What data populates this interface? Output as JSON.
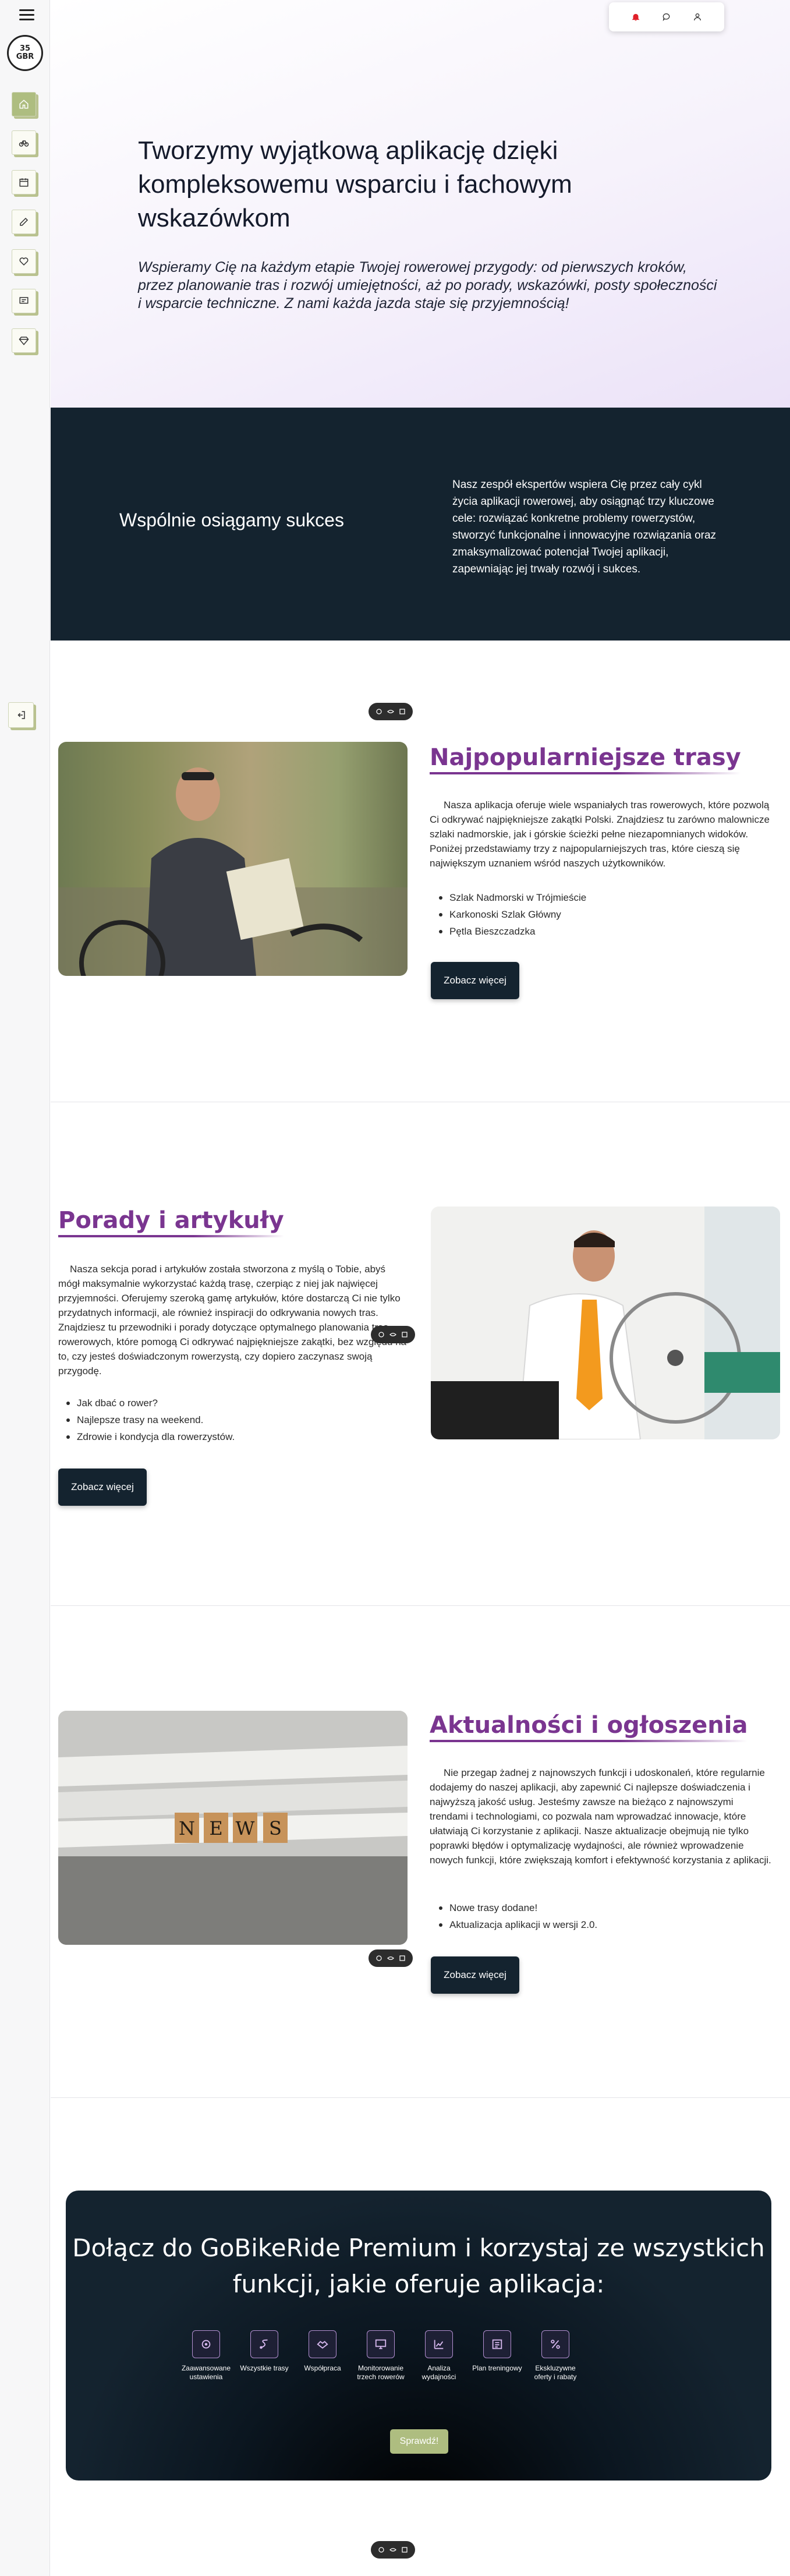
{
  "sidebar": {
    "logo_text_top": "35",
    "logo_text_bottom": "GBR",
    "items": [
      {
        "name": "home",
        "icon": "home-icon"
      },
      {
        "name": "routes",
        "icon": "bike-icon"
      },
      {
        "name": "calendar",
        "icon": "calendar-icon"
      },
      {
        "name": "edit",
        "icon": "edit-icon"
      },
      {
        "name": "community",
        "icon": "heart-hands-icon"
      },
      {
        "name": "messages",
        "icon": "message-icon"
      },
      {
        "name": "premium",
        "icon": "diamond-icon"
      }
    ],
    "logout_icon": "logout-icon"
  },
  "topbar": {
    "icons": [
      "bell-icon",
      "chat-icon",
      "user-icon"
    ],
    "bell_color": "#e0202a"
  },
  "hero": {
    "title": "Tworzymy wyjątkową aplikację dzięki kompleksowemu wsparciu i fachowym wskazówkom",
    "subtitle": "Wspieramy Cię na każdym etapie Twojej rowerowej przygody: od pierwszych kroków, przez planowanie tras i rozwój umiejętności, aż po porady, wskazówki, posty społeczności i wsparcie techniczne. Z nami każda jazda staje się przyjemnością!"
  },
  "success": {
    "title": "Wspólnie osiągamy sukces",
    "text": "Nasz zespół ekspertów wspiera Cię przez cały cykl życia aplikacji rowerowej, aby osiągnąć trzy kluczowe cele: rozwiązać konkretne problemy rowerzystów, stworzyć funkcjonalne i innowacyjne rozwiązania oraz zmaksymalizować potencjał Twojej aplikacji, zapewniając jej trwały rozwój i sukces."
  },
  "routes": {
    "title": "Najpopularniejsze trasy",
    "text": "Nasza aplikacja oferuje wiele wspaniałych tras rowerowych, które pozwolą Ci odkrywać najpiękniejsze zakątki Polski. Znajdziesz tu zarówno malownicze szlaki nadmorskie, jak i górskie ścieżki pełne niezapomnianych widoków. Poniżej przedstawiamy trzy z najpopularniejszych tras, które cieszą się największym uznaniem wśród naszych użytkowników.",
    "bullets": [
      "Szlak Nadmorski w Trójmieście",
      "Karkonoski Szlak Główny",
      "Pętla Bieszczadzka"
    ],
    "button": "Zobacz więcej"
  },
  "tips": {
    "title": "Porady i artykuły",
    "text": "Nasza sekcja porad i artykułów została stworzona z myślą o Tobie, abyś mógł maksymalnie wykorzystać każdą trasę, czerpiąc z niej jak najwięcej przyjemności. Oferujemy szeroką gamę artykułów, które dostarczą Ci nie tylko przydatnych informacji, ale również inspiracji do odkrywania nowych tras. Znajdziesz tu przewodniki i porady dotyczące optymalnego planowania tras rowerowych, które pomogą Ci odkrywać najpiękniejsze zakątki, bez względu na to, czy jesteś doświadczonym rowerzystą, czy dopiero zaczynasz swoją przygodę.",
    "bullets": [
      "Jak dbać o rower?",
      "Najlepsze trasy na weekend.",
      "Zdrowie i kondycja dla rowerzystów."
    ],
    "button": "Zobacz więcej"
  },
  "news": {
    "title": "Aktualności i ogłoszenia",
    "text": "Nie przegap żadnej z najnowszych funkcji i udoskonaleń, które regularnie dodajemy do naszej aplikacji, aby zapewnić Ci najlepsze doświadczenia i najwyższą jakość usług. Jesteśmy zawsze na bieżąco z najnowszymi trendami i technologiami, co pozwala nam wprowadzać innowacje, które ułatwiają Ci korzystanie z aplikacji. Nasze aktualizacje obejmują nie tylko poprawki błędów i optymalizację wydajności, ale również wprowadzenie nowych funkcji, które zwiększają komfort i efektywność korzystania z aplikacji.",
    "bullets": [
      "Nowe trasy dodane!",
      "Aktualizacja aplikacji w wersji 2.0."
    ],
    "button": "Zobacz więcej",
    "image_word": "NEWS"
  },
  "premium": {
    "title": "Dołącz do GoBikeRide Premium i korzystaj ze wszystkich funkcji, jakie oferuje aplikacja:",
    "features": [
      {
        "label": "Zaawansowane ustawienia",
        "icon": "settings-icon"
      },
      {
        "label": "Wszystkie trasy",
        "icon": "route-icon"
      },
      {
        "label": "Współpraca",
        "icon": "handshake-icon"
      },
      {
        "label": "Monitorowanie trzech rowerów",
        "icon": "monitor-icon"
      },
      {
        "label": "Analiza wydajności",
        "icon": "chart-icon"
      },
      {
        "label": "Plan treningowy",
        "icon": "plan-icon"
      },
      {
        "label": "Ekskluzywne oferty i rabaty",
        "icon": "percent-icon"
      }
    ],
    "button": "Sprawdź!",
    "accent": "#aebd80"
  },
  "colors": {
    "dark": "#14232f",
    "purple": "#7a3590",
    "sage": "#aebd80"
  }
}
